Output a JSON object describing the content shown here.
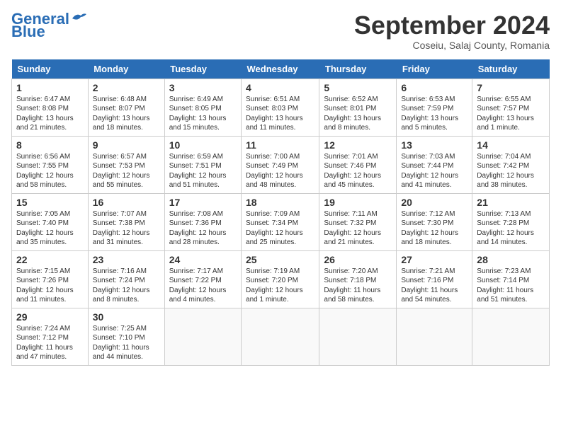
{
  "header": {
    "logo_line1": "General",
    "logo_line2": "Blue",
    "month_title": "September 2024",
    "location": "Coseiu, Salaj County, Romania"
  },
  "weekdays": [
    "Sunday",
    "Monday",
    "Tuesday",
    "Wednesday",
    "Thursday",
    "Friday",
    "Saturday"
  ],
  "weeks": [
    [
      {
        "day": "1",
        "info": "Sunrise: 6:47 AM\nSunset: 8:08 PM\nDaylight: 13 hours\nand 21 minutes."
      },
      {
        "day": "2",
        "info": "Sunrise: 6:48 AM\nSunset: 8:07 PM\nDaylight: 13 hours\nand 18 minutes."
      },
      {
        "day": "3",
        "info": "Sunrise: 6:49 AM\nSunset: 8:05 PM\nDaylight: 13 hours\nand 15 minutes."
      },
      {
        "day": "4",
        "info": "Sunrise: 6:51 AM\nSunset: 8:03 PM\nDaylight: 13 hours\nand 11 minutes."
      },
      {
        "day": "5",
        "info": "Sunrise: 6:52 AM\nSunset: 8:01 PM\nDaylight: 13 hours\nand 8 minutes."
      },
      {
        "day": "6",
        "info": "Sunrise: 6:53 AM\nSunset: 7:59 PM\nDaylight: 13 hours\nand 5 minutes."
      },
      {
        "day": "7",
        "info": "Sunrise: 6:55 AM\nSunset: 7:57 PM\nDaylight: 13 hours\nand 1 minute."
      }
    ],
    [
      {
        "day": "8",
        "info": "Sunrise: 6:56 AM\nSunset: 7:55 PM\nDaylight: 12 hours\nand 58 minutes."
      },
      {
        "day": "9",
        "info": "Sunrise: 6:57 AM\nSunset: 7:53 PM\nDaylight: 12 hours\nand 55 minutes."
      },
      {
        "day": "10",
        "info": "Sunrise: 6:59 AM\nSunset: 7:51 PM\nDaylight: 12 hours\nand 51 minutes."
      },
      {
        "day": "11",
        "info": "Sunrise: 7:00 AM\nSunset: 7:49 PM\nDaylight: 12 hours\nand 48 minutes."
      },
      {
        "day": "12",
        "info": "Sunrise: 7:01 AM\nSunset: 7:46 PM\nDaylight: 12 hours\nand 45 minutes."
      },
      {
        "day": "13",
        "info": "Sunrise: 7:03 AM\nSunset: 7:44 PM\nDaylight: 12 hours\nand 41 minutes."
      },
      {
        "day": "14",
        "info": "Sunrise: 7:04 AM\nSunset: 7:42 PM\nDaylight: 12 hours\nand 38 minutes."
      }
    ],
    [
      {
        "day": "15",
        "info": "Sunrise: 7:05 AM\nSunset: 7:40 PM\nDaylight: 12 hours\nand 35 minutes."
      },
      {
        "day": "16",
        "info": "Sunrise: 7:07 AM\nSunset: 7:38 PM\nDaylight: 12 hours\nand 31 minutes."
      },
      {
        "day": "17",
        "info": "Sunrise: 7:08 AM\nSunset: 7:36 PM\nDaylight: 12 hours\nand 28 minutes."
      },
      {
        "day": "18",
        "info": "Sunrise: 7:09 AM\nSunset: 7:34 PM\nDaylight: 12 hours\nand 25 minutes."
      },
      {
        "day": "19",
        "info": "Sunrise: 7:11 AM\nSunset: 7:32 PM\nDaylight: 12 hours\nand 21 minutes."
      },
      {
        "day": "20",
        "info": "Sunrise: 7:12 AM\nSunset: 7:30 PM\nDaylight: 12 hours\nand 18 minutes."
      },
      {
        "day": "21",
        "info": "Sunrise: 7:13 AM\nSunset: 7:28 PM\nDaylight: 12 hours\nand 14 minutes."
      }
    ],
    [
      {
        "day": "22",
        "info": "Sunrise: 7:15 AM\nSunset: 7:26 PM\nDaylight: 12 hours\nand 11 minutes."
      },
      {
        "day": "23",
        "info": "Sunrise: 7:16 AM\nSunset: 7:24 PM\nDaylight: 12 hours\nand 8 minutes."
      },
      {
        "day": "24",
        "info": "Sunrise: 7:17 AM\nSunset: 7:22 PM\nDaylight: 12 hours\nand 4 minutes."
      },
      {
        "day": "25",
        "info": "Sunrise: 7:19 AM\nSunset: 7:20 PM\nDaylight: 12 hours\nand 1 minute."
      },
      {
        "day": "26",
        "info": "Sunrise: 7:20 AM\nSunset: 7:18 PM\nDaylight: 11 hours\nand 58 minutes."
      },
      {
        "day": "27",
        "info": "Sunrise: 7:21 AM\nSunset: 7:16 PM\nDaylight: 11 hours\nand 54 minutes."
      },
      {
        "day": "28",
        "info": "Sunrise: 7:23 AM\nSunset: 7:14 PM\nDaylight: 11 hours\nand 51 minutes."
      }
    ],
    [
      {
        "day": "29",
        "info": "Sunrise: 7:24 AM\nSunset: 7:12 PM\nDaylight: 11 hours\nand 47 minutes."
      },
      {
        "day": "30",
        "info": "Sunrise: 7:25 AM\nSunset: 7:10 PM\nDaylight: 11 hours\nand 44 minutes."
      },
      {
        "day": "",
        "info": ""
      },
      {
        "day": "",
        "info": ""
      },
      {
        "day": "",
        "info": ""
      },
      {
        "day": "",
        "info": ""
      },
      {
        "day": "",
        "info": ""
      }
    ]
  ]
}
